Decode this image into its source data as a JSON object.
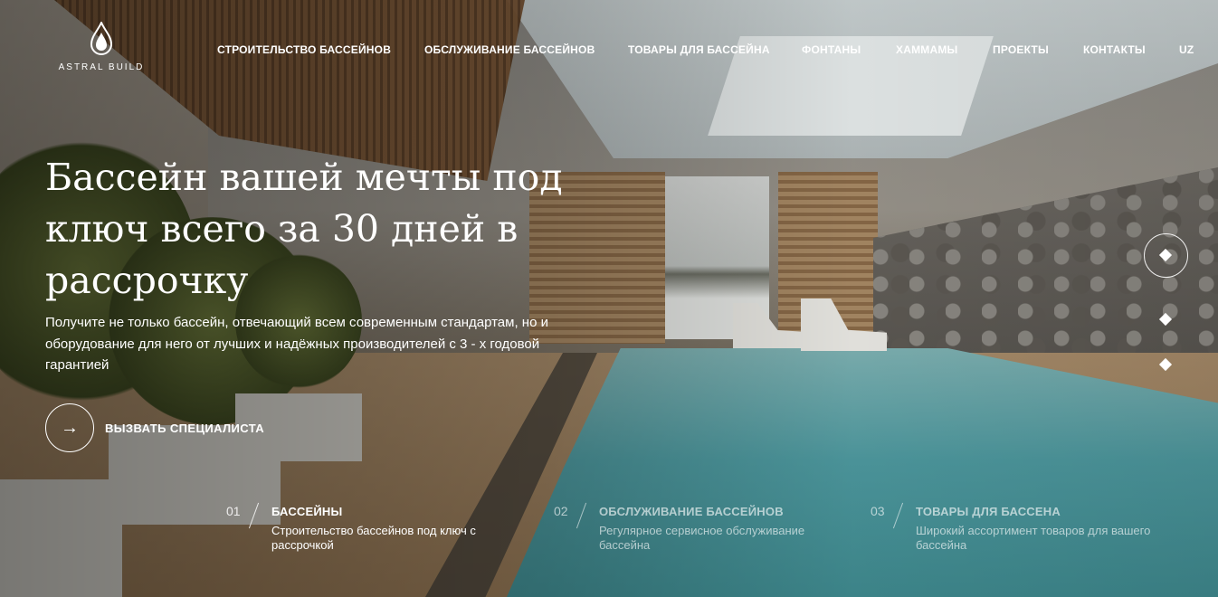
{
  "brand": {
    "logo_text": "ASTRAL BUILD",
    "icon": "water-drop-logo-icon"
  },
  "nav": {
    "items": [
      {
        "label": "СТРОИТЕЛЬСТВО БАССЕЙНОВ"
      },
      {
        "label": "ОБСЛУЖИВАНИЕ БАССЕЙНОВ"
      },
      {
        "label": "ТОВАРЫ ДЛЯ БАССЕЙНА"
      },
      {
        "label": "ФОНТАНЫ"
      },
      {
        "label": "ХАММАМЫ"
      },
      {
        "label": "ПРОЕКТЫ"
      },
      {
        "label": "КОНТАКТЫ"
      },
      {
        "label": "UZ"
      }
    ]
  },
  "hero": {
    "title": "Бассейн вашей мечты под ключ всего за 30 дней в рассрочку",
    "description": "Получите не только бассейн, отвечающий всем современным стандартам, но и оборудование для него от лучших и надёжных производителей с 3 - х годовой гарантией",
    "cta_label": "ВЫЗВАТЬ СПЕЦИАЛИСТА",
    "cta_icon": "arrow-right-icon"
  },
  "slider": {
    "active_index": 0,
    "count": 3
  },
  "features": [
    {
      "num": "01",
      "title": "БАССЕЙНЫ",
      "desc": "Строительство бассейнов под ключ с рассрочкой"
    },
    {
      "num": "02",
      "title": "ОБСЛУЖИВАНИЕ БАССЕЙНОВ",
      "desc": "Регулярное сервисное обслуживание бассейна"
    },
    {
      "num": "03",
      "title": "ТОВАРЫ ДЛЯ БАССЕНА",
      "desc": "Широкий ассортимент товаров для вашего бассейна"
    }
  ]
}
